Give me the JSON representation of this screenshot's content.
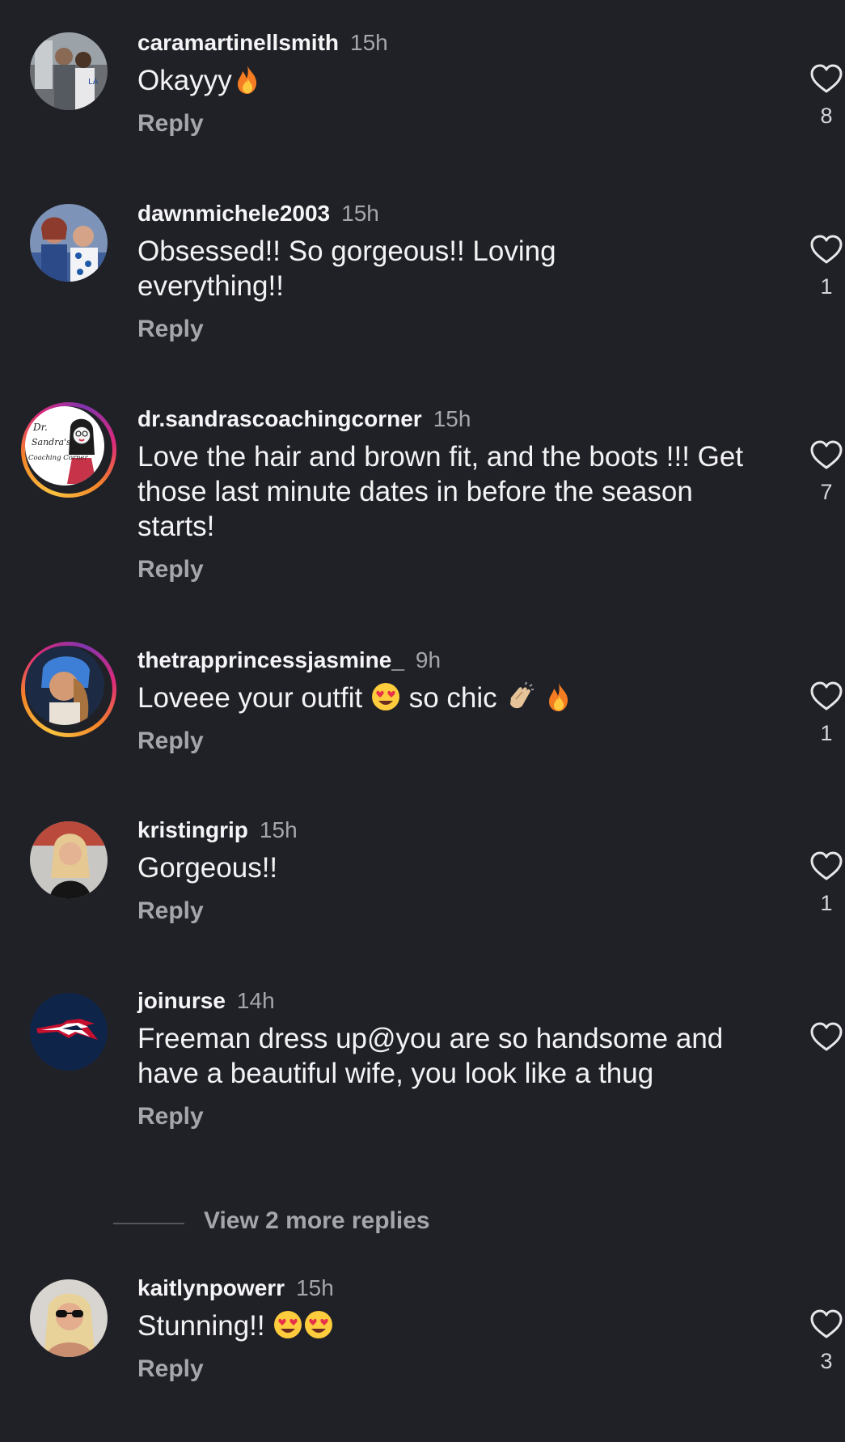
{
  "comments": [
    {
      "username": "caramartinellsmith",
      "time": "15h",
      "text": "Okayyy",
      "emojis": [
        "fire"
      ],
      "reply": "Reply",
      "likes": "8",
      "avatar": "couple-photo"
    },
    {
      "username": "dawnmichele2003",
      "time": "15h",
      "text": "Obsessed!! So gorgeous!! Loving everything!!",
      "reply": "Reply",
      "likes": "1",
      "avatar": "couple-photo"
    },
    {
      "username": "dr.sandrascoachingcorner",
      "time": "15h",
      "text": "Love the hair and brown fit, and the boots !!! Get those last minute dates in before the season starts!",
      "reply": "Reply",
      "likes": "7",
      "avatar": "coaching-corner-logo",
      "avatar_logo_text": [
        "Dr.",
        "Sandra's",
        "Coaching Corner"
      ]
    },
    {
      "username": "thetrapprincessjasmine_",
      "time": "9h",
      "text_a": "Loveee your outfit",
      "text_b": "so chic",
      "emojis": [
        "heart-eyes",
        "clapping-hands",
        "fire"
      ],
      "reply": "Reply",
      "likes": "1",
      "avatar": "woman-portrait"
    },
    {
      "username": "kristingrip",
      "time": "15h",
      "text": "Gorgeous!!",
      "reply": "Reply",
      "likes": "1",
      "avatar": "woman-portrait"
    },
    {
      "username": "joinurse",
      "time": "14h",
      "text": "Freeman dress up@you are so handsome and have a beautiful wife, you look like a thug",
      "reply": "Reply",
      "likes": "",
      "avatar": "patriots-logo"
    },
    {
      "username": "kaitlynpowerr",
      "time": "15h",
      "text": "Stunning!!",
      "emojis": [
        "heart-eyes",
        "heart-eyes"
      ],
      "reply": "Reply",
      "likes": "3",
      "avatar": "woman-sunglasses"
    }
  ],
  "view_more_replies": "View 2 more replies",
  "icons": {
    "like": "heart-outline-icon"
  },
  "colors": {
    "background": "#202126",
    "text": "#f3f3f5",
    "secondary_text": "#a5a6ab",
    "story_ring": [
      "#f9c440",
      "#dd2a7b",
      "#8134af"
    ]
  }
}
